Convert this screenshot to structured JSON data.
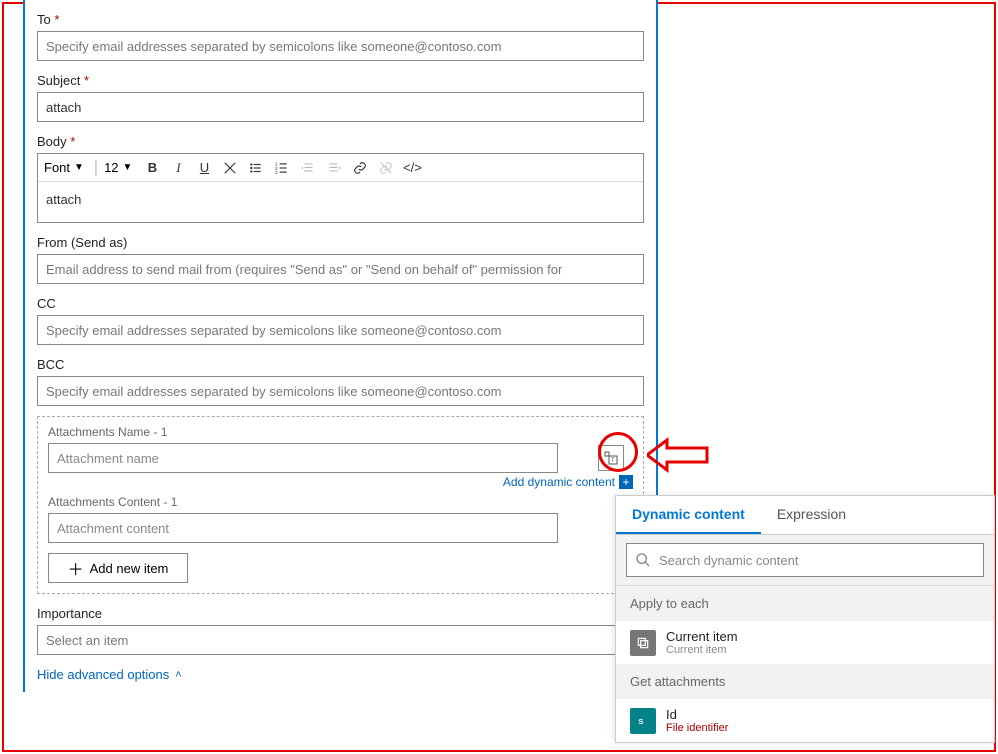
{
  "fields": {
    "to": {
      "label": "To",
      "placeholder": "Specify email addresses separated by semicolons like someone@contoso.com"
    },
    "subject": {
      "label": "Subject",
      "value": "attach"
    },
    "body": {
      "label": "Body",
      "value": "attach",
      "font_label": "Font",
      "size_label": "12"
    },
    "from": {
      "label": "From (Send as)",
      "placeholder": "Email address to send mail from (requires \"Send as\" or \"Send on behalf of\" permission for"
    },
    "cc": {
      "label": "CC",
      "placeholder": "Specify email addresses separated by semicolons like someone@contoso.com"
    },
    "bcc": {
      "label": "BCC",
      "placeholder": "Specify email addresses separated by semicolons like someone@contoso.com"
    },
    "attachments_name": {
      "label": "Attachments Name - 1",
      "placeholder": "Attachment name"
    },
    "attachments_content": {
      "label": "Attachments Content - 1",
      "placeholder": "Attachment content"
    },
    "importance": {
      "label": "Importance",
      "placeholder": "Select an item"
    }
  },
  "actions": {
    "add_dynamic": "Add dynamic content",
    "add_new_item": "Add new item",
    "hide_advanced": "Hide advanced options"
  },
  "dc": {
    "tab_dynamic": "Dynamic content",
    "tab_expression": "Expression",
    "search_placeholder": "Search dynamic content",
    "section1": "Apply to each",
    "item1_title": "Current item",
    "item1_sub": "Current item",
    "section2": "Get attachments",
    "item2_title": "Id",
    "item2_sub": "File identifier"
  }
}
